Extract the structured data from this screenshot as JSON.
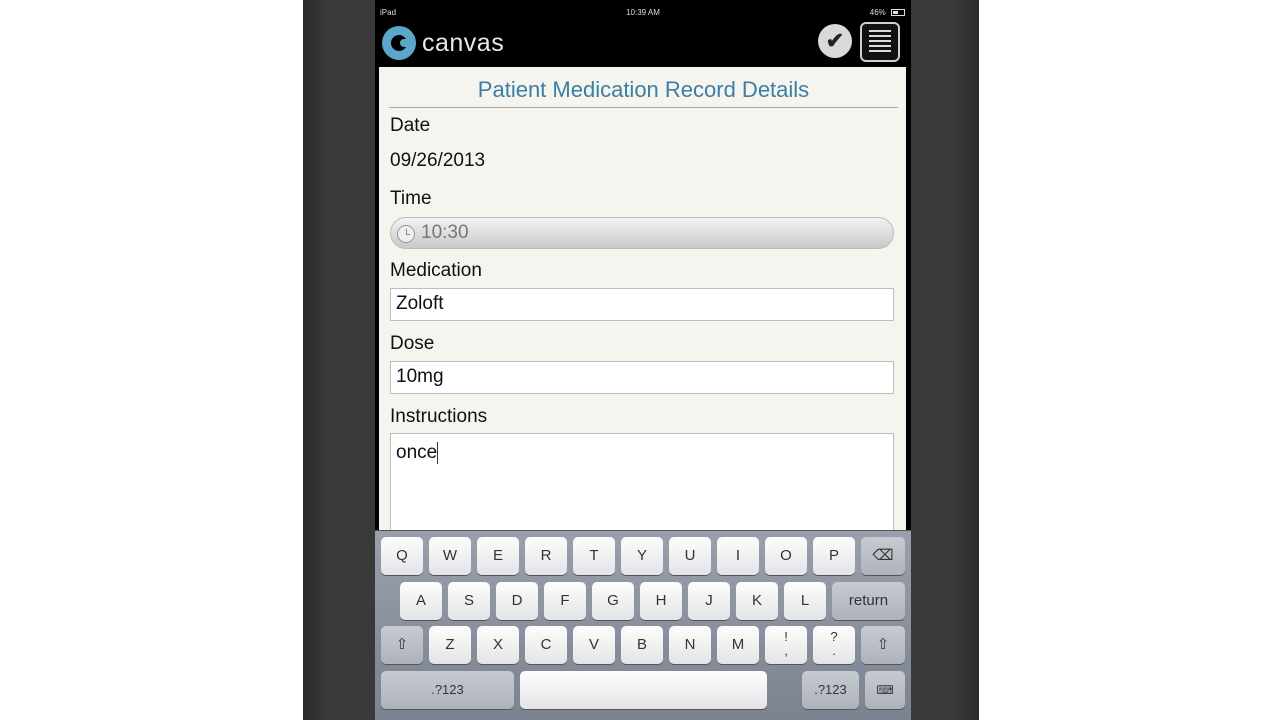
{
  "status_bar": {
    "device": "iPad",
    "time": "10:39 AM",
    "battery": "46%"
  },
  "app": {
    "logo_text": "canvas"
  },
  "form": {
    "title": "Patient Medication Record Details",
    "date_label": "Date",
    "date_value": "09/26/2013",
    "time_label": "Time",
    "time_value": "10:30",
    "medication_label": "Medication",
    "medication_value": "Zoloft",
    "dose_label": "Dose",
    "dose_value": "10mg",
    "instructions_label": "Instructions",
    "instructions_value": "once"
  },
  "keyboard": {
    "row1": [
      "Q",
      "W",
      "E",
      "R",
      "T",
      "Y",
      "U",
      "I",
      "O",
      "P"
    ],
    "row2": [
      "A",
      "S",
      "D",
      "F",
      "G",
      "H",
      "J",
      "K",
      "L"
    ],
    "return": "return",
    "row3": [
      "Z",
      "X",
      "C",
      "V",
      "B",
      "N",
      "M"
    ],
    "punct1": "!\n,",
    "punct2": "?\n.",
    "numbers": ".?123",
    "numbers_right": ".?123"
  }
}
